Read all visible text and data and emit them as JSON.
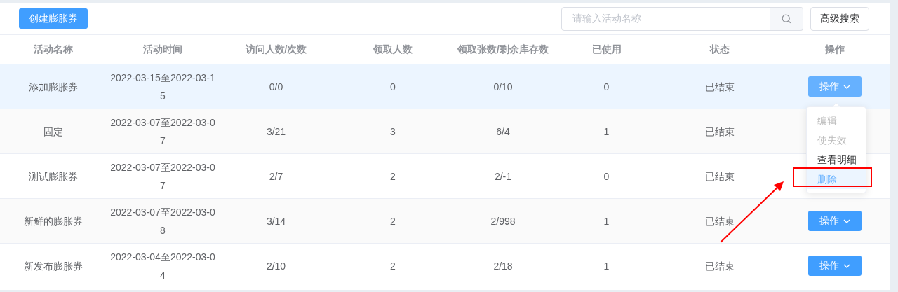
{
  "toolbar": {
    "create_button": "创建膨胀券",
    "search": {
      "placeholder": "请输入活动名称"
    },
    "advanced_button": "高级搜索"
  },
  "table": {
    "columns": [
      "活动名称",
      "活动时间",
      "访问人数/次数",
      "领取人数",
      "领取张数/剩余库存数",
      "已使用",
      "状态",
      "操作"
    ],
    "rows": [
      {
        "name": "添加膨胀券",
        "time": "2022-03-15至2022-03-15",
        "visits": "0/0",
        "receivers": "0",
        "received_stock": "0/10",
        "used": "0",
        "status": "已结束",
        "hovered": true,
        "action": {
          "label": "操作",
          "menu_open": true
        }
      },
      {
        "name": "固定",
        "time": "2022-03-07至2022-03-07",
        "visits": "3/21",
        "receivers": "3",
        "received_stock": "6/4",
        "used": "1",
        "status": "已结束",
        "hovered": false
      },
      {
        "name": "测试膨胀券",
        "time": "2022-03-07至2022-03-07",
        "visits": "2/7",
        "receivers": "2",
        "received_stock": "2/-1",
        "used": "0",
        "status": "已结束",
        "hovered": false
      },
      {
        "name": "新鲜的膨胀券",
        "time": "2022-03-07至2022-03-08",
        "visits": "3/14",
        "receivers": "2",
        "received_stock": "2/998",
        "used": "1",
        "status": "已结束",
        "hovered": false,
        "action": {
          "label": "操作",
          "menu_open": false
        }
      },
      {
        "name": "新发布膨胀券",
        "time": "2022-03-04至2022-03-04",
        "visits": "2/10",
        "receivers": "2",
        "received_stock": "2/18",
        "used": "1",
        "status": "已结束",
        "hovered": false,
        "action": {
          "label": "操作",
          "menu_open": false
        }
      }
    ]
  },
  "dropdown_menu": {
    "items": [
      {
        "label": "编辑",
        "disabled": true,
        "hovered": false,
        "highlighted": false
      },
      {
        "label": "使失效",
        "disabled": true,
        "hovered": false,
        "highlighted": false
      },
      {
        "label": "查看明细",
        "disabled": false,
        "hovered": false,
        "highlighted": false
      },
      {
        "label": "删除",
        "disabled": false,
        "hovered": true,
        "highlighted": true
      }
    ]
  }
}
